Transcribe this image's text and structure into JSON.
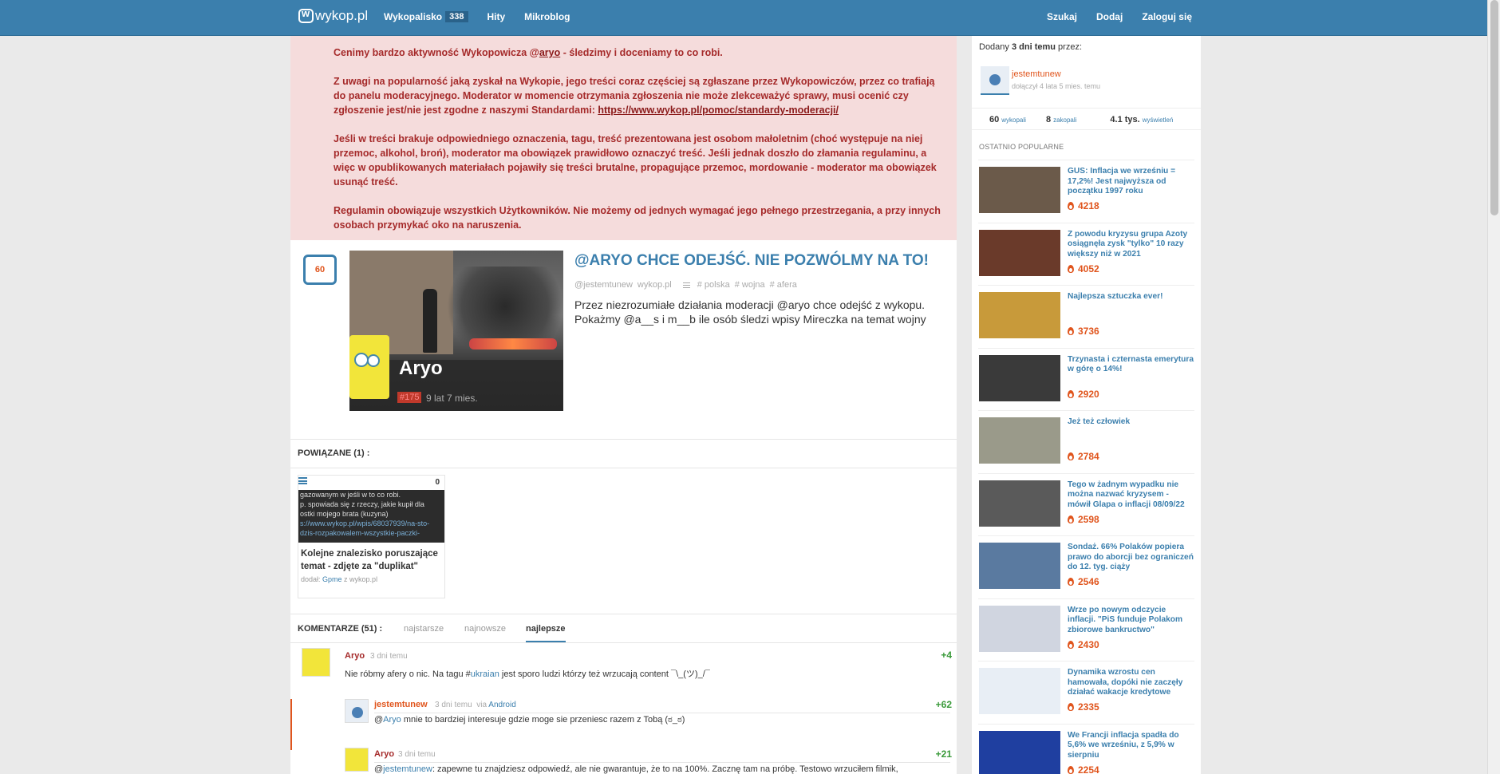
{
  "nav": {
    "logo": "wykop.pl",
    "wykopalisko": "Wykopalisko",
    "wykopalisko_count": "338",
    "hity": "Hity",
    "mikroblog": "Mikroblog",
    "szukaj": "Szukaj",
    "dodaj": "Dodaj",
    "zaloguj": "Zaloguj się"
  },
  "notice": {
    "p1_before": "Cenimy bardzo aktywność Wykopowicza @",
    "p1_link": "aryo",
    "p1_after": " - śledzimy i doceniamy to co robi.",
    "p2": "Z uwagi na popularność jaką zyskał na Wykopie, jego treści coraz częściej są zgłaszane przez Wykopowiczów, przez co trafiają do panelu moderacyjnego. Moderator w momencie otrzymania zgłoszenia nie może zlekceważyć sprawy, musi ocenić czy zgłoszenie jest/nie jest zgodne z naszymi Standardami: ",
    "p2_link": "https://www.wykop.pl/pomoc/standardy-moderacji/",
    "p3": "Jeśli w treści brakuje odpowiedniego oznaczenia, tagu, treść prezentowana jest osobom małoletnim (choć występuje na niej przemoc, alkohol, broń), moderator ma obowiązek prawidłowo oznaczyć treść. Jeśli jednak doszło do złamania regulaminu, a więc w opublikowanych materiałach pojawiły się treści brutalne, propagujące przemoc, mordowanie - moderator ma obowiązek usunąć treść.",
    "p4": "Regulamin obowiązuje wszystkich Użytkowników. Nie możemy od jednych wymagać jego pełnego przestrzegania, a przy innych osobach przymykać oko na naruszenia."
  },
  "article": {
    "votes": "60",
    "title": "@ARYO CHCE ODEJŚĆ. NIE POZWÓLMY NA TO!",
    "author": "@jestemtunew",
    "source": "wykop.pl",
    "tags": [
      "# polska",
      "# wojna",
      "# afera"
    ],
    "description": "Przez niezrozumiałe działania moderacji @aryo chce odejść z wykopu. Pokażmy @a__s i m__b ile osób śledzi wpisy Mireczka na temat wojny",
    "thumb_name": "Aryo",
    "thumb_badge": "#175",
    "thumb_age": "9 lat 7 mies."
  },
  "related": {
    "header": "POWIĄZANE (1) :",
    "count": "0",
    "thumb_lines": [
      "gazowanym w jeśli w to co robi.",
      "p. spowiada się z rzeczy, jakie kupił dla",
      "ostki mojego brata (kuzyna)"
    ],
    "thumb_link": "s://www.wykop.pl/wpis/68037939/na-sto-dzis-rozpakowalem-wszystkie-paczki-",
    "title": "Kolejne znalezisko poruszające temat - zdjęte za \"duplikat\"",
    "added_by_prefix": "dodał: ",
    "added_by": "Gpme",
    "added_from": " z wykop.pl"
  },
  "comments_header": {
    "label": "KOMENTARZE (51) :",
    "tab_oldest": "najstarsze",
    "tab_newest": "najnowsze",
    "tab_best": "najlepsze"
  },
  "comments": [
    {
      "author": "Aryo",
      "time": "3 dni temu",
      "score": "+4",
      "text_before": "Nie róbmy afery o nic. Na tagu #",
      "text_link": "ukraian",
      "text_after": " jest sporo ludzi którzy też wrzucają content ¯\\_(ツ)_/¯"
    },
    {
      "author": "jestemtunew",
      "time": "3 dni temu",
      "via": "via ",
      "via_app": "Android",
      "score": "+62",
      "text_before": "@",
      "text_link": "Aryo",
      "text_after": " mnie to bardziej interesuje gdzie moge sie przeniesc razem z Tobą (ಠ_ಠ)"
    },
    {
      "author": "Aryo",
      "time": "3 dni temu",
      "score": "+21",
      "text_before": "@",
      "text_link": "jestemtunew",
      "text_after": ": zapewne tu znajdziesz odpowiedź, ale nie gwarantuje, że to na 100%. Zacznę tam na próbę. Testowo wrzuciłem filmik,"
    }
  ],
  "sidebar": {
    "added_prefix": "Dodany ",
    "added_time": "3 dni temu",
    "added_suffix": " przez:",
    "user": "jestemtunew",
    "joined": "dołączył 4 lata 5 mies. temu",
    "stat1_value": "60",
    "stat1_label": "wykopali",
    "stat2_value": "8",
    "stat2_label": "zakopali",
    "stat3_value": "4.1 tys.",
    "stat3_label": "wyświetleń",
    "popular_header": "OSTATNIO POPULARNE",
    "popular": [
      {
        "title": "GUS: Inflacja we wrześniu = 17,2%! Jest najwyższa od początku 1997 roku",
        "score": "4218",
        "color": "#6b5a4a"
      },
      {
        "title": "Z powodu kryzysu grupa Azoty osiągnęła zysk \"tylko\" 10 razy większy niż w 2021",
        "score": "4052",
        "color": "#6a3a2a"
      },
      {
        "title": "Najlepsza sztuczka ever!",
        "score": "3736",
        "color": "#c89a3a"
      },
      {
        "title": "Trzynasta i czternasta emerytura w górę o 14%!",
        "score": "2920",
        "color": "#3a3a3a"
      },
      {
        "title": "Jeż też człowiek",
        "score": "2784",
        "color": "#9a9a8a"
      },
      {
        "title": "Tego w żadnym wypadku nie można nazwać kryzysem - mówił Glapa o inflacji 08/09/22",
        "score": "2598",
        "color": "#5a5a5a"
      },
      {
        "title": "Sondaż. 66% Polaków popiera prawo do aborcji bez ograniczeń do 12. tyg. ciąży",
        "score": "2546",
        "color": "#5a7aa0"
      },
      {
        "title": "Wrze po nowym odczycie inflacji. \"PiS funduje Polakom zbiorowe bankructwo\"",
        "score": "2430",
        "color": "#d0d5e0"
      },
      {
        "title": "Dynamika wzrostu cen hamowała, dopóki nie zaczęły działać wakacje kredytowe",
        "score": "2335",
        "color": "#e8eef5"
      },
      {
        "title": "We Francji inflacja spadła do 5,6% we wrześniu, z 5,9% w sierpniu",
        "score": "2254",
        "color": "#1f3fa0"
      }
    ]
  }
}
